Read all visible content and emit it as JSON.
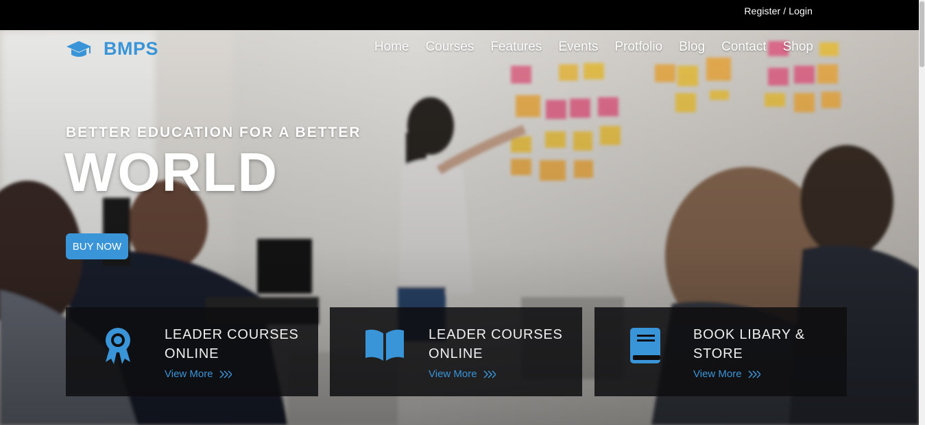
{
  "topbar": {
    "auth_link": "Register / Login"
  },
  "header": {
    "brand": "BMPS",
    "nav": [
      "Home",
      "Courses",
      "Features",
      "Events",
      "Protfolio",
      "Blog",
      "Contact",
      "Shop"
    ]
  },
  "hero": {
    "tagline": "BETTER EDUCATION FOR A BETTER",
    "headline": "WORLD",
    "cta_label": "BUY NOW"
  },
  "features": [
    {
      "icon": "award-ribbon-icon",
      "title": "LEADER COURSES ONLINE",
      "link": "View More"
    },
    {
      "icon": "open-book-icon",
      "title": "LEADER COURSES ONLINE",
      "link": "View More"
    },
    {
      "icon": "closed-book-icon",
      "title": "BOOK LIBARY & STORE",
      "link": "View More"
    }
  ],
  "colors": {
    "accent": "#3a95d8",
    "topbar": "#000000",
    "card_background": "#0e0e10"
  }
}
